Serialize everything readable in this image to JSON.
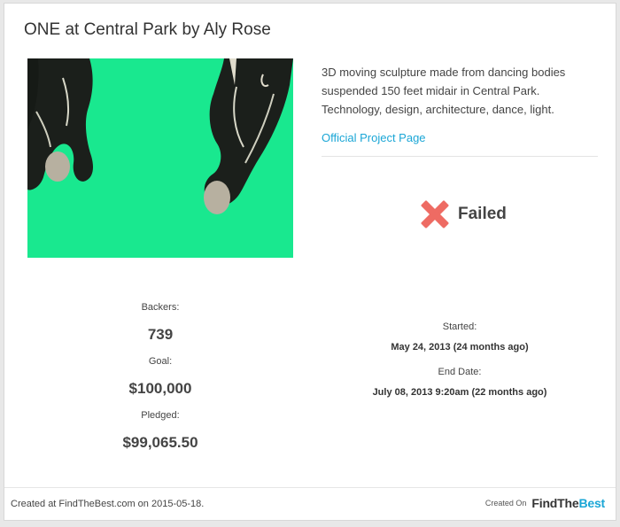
{
  "project": {
    "title": "ONE at Central Park by Aly Rose",
    "description": "3D moving sculpture made from dancing bodies suspended 150 feet midair in Central Park. Technology, design, architecture, dance, light.",
    "link_label": "Official Project Page",
    "status": "Failed",
    "status_icon": "x-mark-icon",
    "status_color": "#ee6b63"
  },
  "stats": {
    "backers_label": "Backers:",
    "backers_value": "739",
    "goal_label": "Goal:",
    "goal_value": "$100,000",
    "pledged_label": "Pledged:",
    "pledged_value": "$99,065.50",
    "started_label": "Started:",
    "started_value": "May 24, 2013 (24 months ago)",
    "end_label": "End Date:",
    "end_value": "July 08, 2013 9:20am (22 months ago)"
  },
  "footer": {
    "created_text": "Created at FindTheBest.com on 2015-05-18.",
    "created_on": "Created On",
    "brand_part1": "FindThe",
    "brand_part2": "Best"
  },
  "colors": {
    "accent": "#1aa6d6",
    "photo_background": "#19e88f"
  }
}
